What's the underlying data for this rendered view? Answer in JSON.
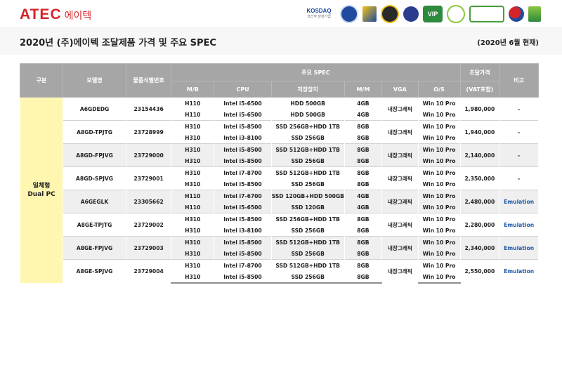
{
  "header": {
    "logo_main": "ATEC",
    "logo_sub": "에이텍",
    "cert_kosdaq": "KOSDAQ",
    "cert_kosdaq_sub": "코스닥 상장기업"
  },
  "title": "2020년 (주)에이텍 조달제품 가격 및 주요 SPEC",
  "as_of": "(2020년 6월 현재)",
  "table": {
    "headers": {
      "category": "구분",
      "model": "모델명",
      "product_id": "물품식별번호",
      "main_spec": "주요 SPEC",
      "price": "조달가격",
      "price_note": "(VAT포함)",
      "remark": "비고",
      "mb": "M/B",
      "cpu": "CPU",
      "storage": "저장장치",
      "mem": "M/M",
      "vga": "VGA",
      "os": "O/S"
    },
    "category": {
      "line1": "일체형",
      "line2": "Dual PC"
    },
    "rows": [
      {
        "model": "A6GDEDG",
        "id": "23154436",
        "vga": "내장그래픽",
        "price": "1,980,000",
        "remark": "-",
        "a": {
          "mb": "H110",
          "cpu": "Intel i5-6500",
          "storage": "HDD 500GB",
          "mem": "4GB",
          "os": "Win 10 Pro"
        },
        "b": {
          "mb": "H110",
          "cpu": "Intel i5-6500",
          "storage": "HDD 500GB",
          "mem": "4GB",
          "os": "Win 10 Pro"
        }
      },
      {
        "model": "A8GD-TPJTG",
        "id": "23728999",
        "vga": "내장그래픽",
        "price": "1,940,000",
        "remark": "-",
        "a": {
          "mb": "H310",
          "cpu": "Intel i5-8500",
          "storage": "SSD 256GB+HDD 1TB",
          "mem": "8GB",
          "os": "Win 10 Pro"
        },
        "b": {
          "mb": "H310",
          "cpu": "Intel i3-8100",
          "storage": "SSD 256GB",
          "mem": "8GB",
          "os": "Win 10 Pro"
        }
      },
      {
        "model": "A8GD-FPJVG",
        "id": "23729000",
        "vga": "내장그래픽",
        "price": "2,140,000",
        "remark": "-",
        "a": {
          "mb": "H310",
          "cpu": "Intel i5-8500",
          "storage": "SSD 512GB+HDD 1TB",
          "mem": "8GB",
          "os": "Win 10 Pro"
        },
        "b": {
          "mb": "H310",
          "cpu": "Intel i5-8500",
          "storage": "SSD 256GB",
          "mem": "8GB",
          "os": "Win 10 Pro"
        }
      },
      {
        "model": "A8GD-SPJVG",
        "id": "23729001",
        "vga": "내장그래픽",
        "price": "2,350,000",
        "remark": "-",
        "a": {
          "mb": "H310",
          "cpu": "Intel i7-8700",
          "storage": "SSD 512GB+HDD 1TB",
          "mem": "8GB",
          "os": "Win 10 Pro"
        },
        "b": {
          "mb": "H310",
          "cpu": "Intel i5-8500",
          "storage": "SSD 256GB",
          "mem": "8GB",
          "os": "Win 10 Pro"
        }
      },
      {
        "model": "A6GEGLK",
        "id": "23305662",
        "vga": "내장그래픽",
        "price": "2,480,000",
        "remark": "Emulation",
        "a": {
          "mb": "H110",
          "cpu": "Intel i7-6700",
          "storage": "SSD 120GB+HDD 500GB",
          "mem": "4GB",
          "os": "Win 10 Pro"
        },
        "b": {
          "mb": "H110",
          "cpu": "Intel i5-6500",
          "storage": "SSD 120GB",
          "mem": "4GB",
          "os": "Win 10 Pro"
        }
      },
      {
        "model": "A8GE-TPJTG",
        "id": "23729002",
        "vga": "내장그래픽",
        "price": "2,280,000",
        "remark": "Emulation",
        "a": {
          "mb": "H310",
          "cpu": "Intel i5-8500",
          "storage": "SSD 256GB+HDD 1TB",
          "mem": "8GB",
          "os": "Win 10 Pro"
        },
        "b": {
          "mb": "H310",
          "cpu": "Intel i3-8100",
          "storage": "SSD 256GB",
          "mem": "8GB",
          "os": "Win 10 Pro"
        }
      },
      {
        "model": "A8GE-FPJVG",
        "id": "23729003",
        "vga": "내장그래픽",
        "price": "2,340,000",
        "remark": "Emulation",
        "a": {
          "mb": "H310",
          "cpu": "Intel i5-8500",
          "storage": "SSD 512GB+HDD 1TB",
          "mem": "8GB",
          "os": "Win 10 Pro"
        },
        "b": {
          "mb": "H310",
          "cpu": "Intel i5-8500",
          "storage": "SSD 256GB",
          "mem": "8GB",
          "os": "Win 10 Pro"
        }
      },
      {
        "model": "A8GE-SPJVG",
        "id": "23729004",
        "vga": "내장그래픽",
        "price": "2,550,000",
        "remark": "Emulation",
        "a": {
          "mb": "H310",
          "cpu": "Intel i7-8700",
          "storage": "SSD 512GB+HDD 1TB",
          "mem": "8GB",
          "os": "Win 10 Pro"
        },
        "b": {
          "mb": "H310",
          "cpu": "Intel i5-8500",
          "storage": "SSD 256GB",
          "mem": "8GB",
          "os": "Win 10 Pro"
        }
      }
    ]
  }
}
